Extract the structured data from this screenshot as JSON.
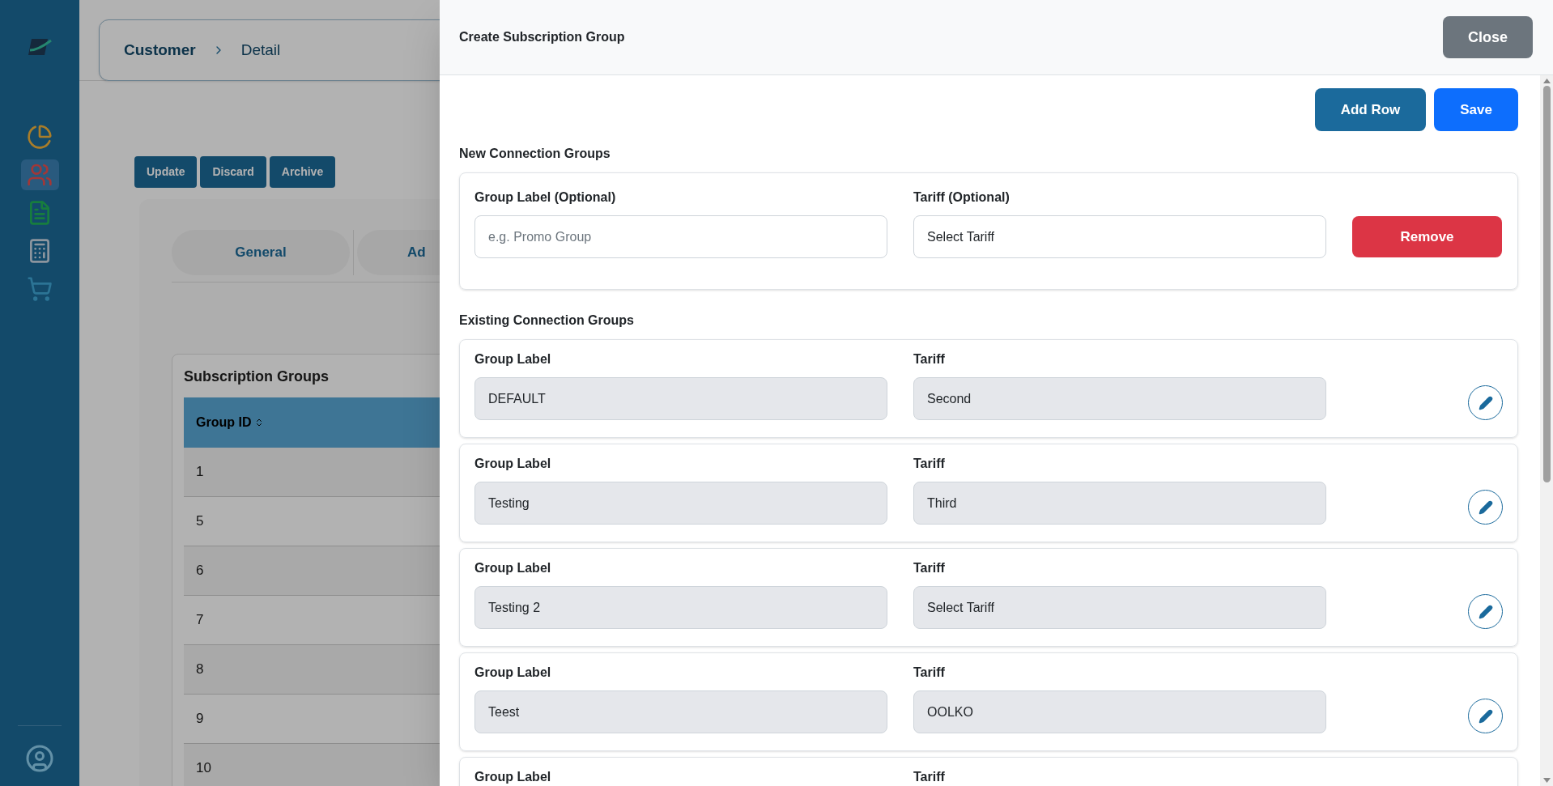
{
  "sidebar": {
    "items": [
      {
        "kind": "chart",
        "selected": false
      },
      {
        "kind": "people",
        "selected": true
      },
      {
        "kind": "document",
        "selected": false
      },
      {
        "kind": "report",
        "selected": false
      },
      {
        "kind": "cart",
        "selected": false
      }
    ]
  },
  "breadcrumb": [
    "Customer",
    "Detail"
  ],
  "actions": [
    "Update",
    "Discard",
    "Archive"
  ],
  "tabs": [
    "General",
    "Ad"
  ],
  "table": {
    "title": "Subscription Groups",
    "columns": [
      "Group ID"
    ],
    "rows": [
      "1",
      "5",
      "6",
      "7",
      "8",
      "9",
      "10"
    ]
  },
  "panel": {
    "title": "Create Subscription Group",
    "close": "Close",
    "add_row": "Add Row",
    "save": "Save",
    "new_section": {
      "title": "New Connection Groups",
      "rows": [
        {
          "label_caption": "Group Label (Optional)",
          "label_placeholder": "e.g. Promo Group",
          "tariff_caption": "Tariff (Optional)",
          "tariff_value": "Select Tariff",
          "remove": "Remove"
        }
      ]
    },
    "existing_section": {
      "title": "Existing Connection Groups",
      "rows": [
        {
          "label_caption": "Group Label",
          "label_value": "DEFAULT",
          "tariff_caption": "Tariff",
          "tariff_value": "Second"
        },
        {
          "label_caption": "Group Label",
          "label_value": "Testing",
          "tariff_caption": "Tariff",
          "tariff_value": "Third"
        },
        {
          "label_caption": "Group Label",
          "label_value": "Testing 2",
          "tariff_caption": "Tariff",
          "tariff_value": "Select Tariff"
        },
        {
          "label_caption": "Group Label",
          "label_value": "Teest",
          "tariff_caption": "Tariff",
          "tariff_value": "OOLKO"
        },
        {
          "label_caption": "Group Label",
          "tariff_caption": "Tariff"
        }
      ]
    }
  }
}
